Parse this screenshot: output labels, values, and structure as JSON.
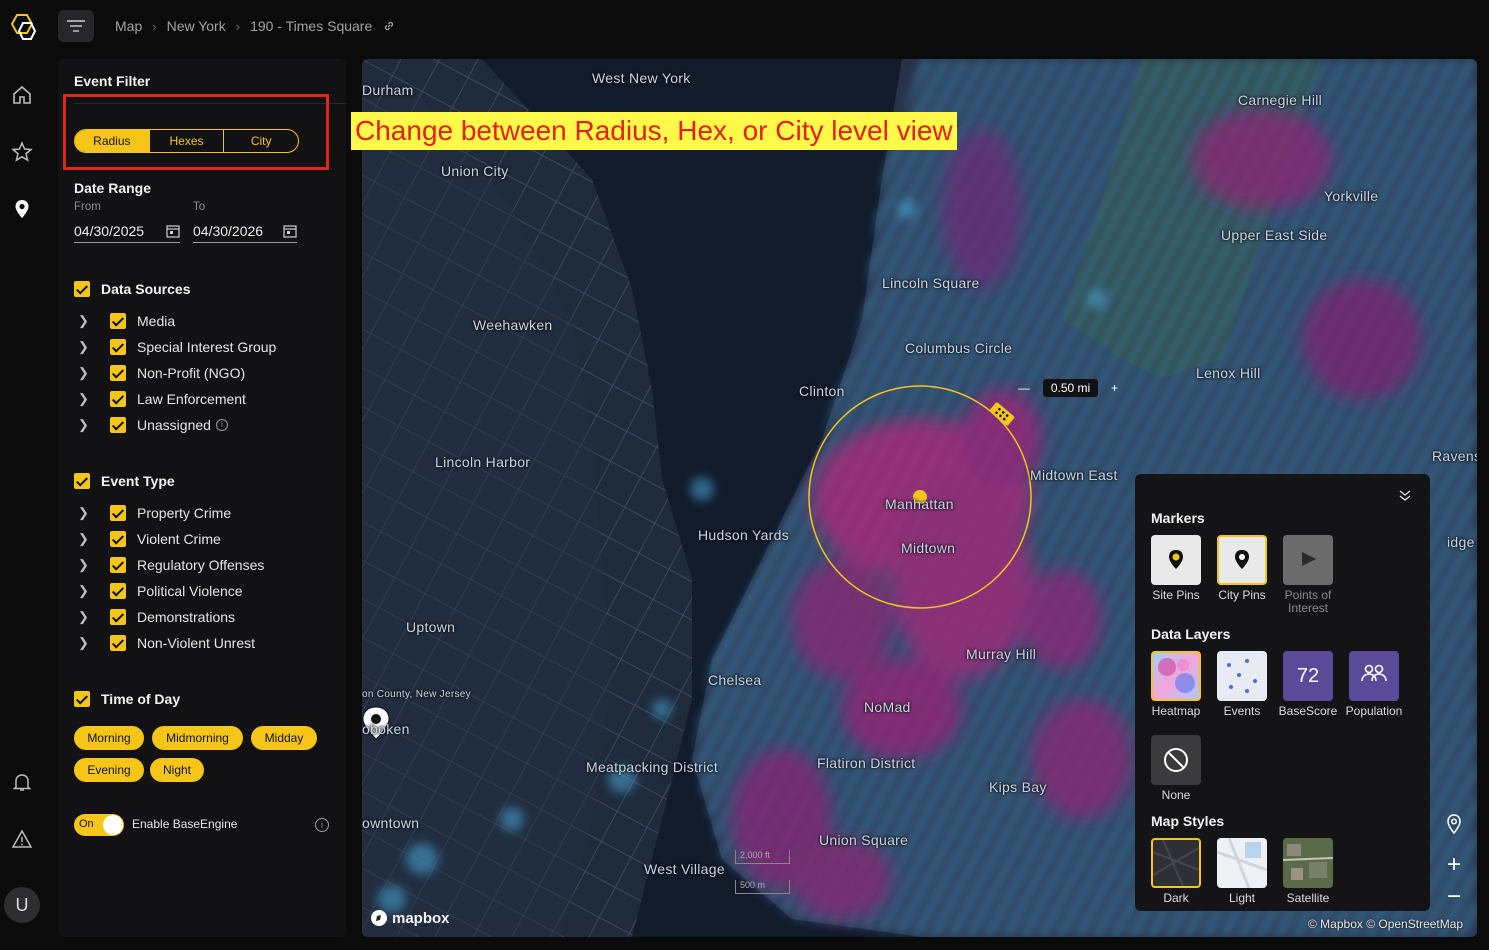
{
  "breadcrumb": {
    "items": [
      "Map",
      "New York",
      "190 - Times Square"
    ]
  },
  "rail": {
    "avatar_initial": "U"
  },
  "filter": {
    "title": "Event Filter",
    "view_modes": [
      "Radius",
      "Hexes",
      "City"
    ],
    "active_view_mode": "Radius",
    "date_range": {
      "label": "Date Range",
      "from_label": "From",
      "from_value": "04/30/2025",
      "to_label": "To",
      "to_value": "04/30/2026"
    },
    "data_sources": {
      "label": "Data Sources",
      "items": [
        "Media",
        "Special Interest Group",
        "Non-Profit (NGO)",
        "Law Enforcement",
        "Unassigned"
      ]
    },
    "event_type": {
      "label": "Event Type",
      "items": [
        "Property Crime",
        "Violent Crime",
        "Regulatory Offenses",
        "Political Violence",
        "Demonstrations",
        "Non-Violent Unrest"
      ]
    },
    "time_of_day": {
      "label": "Time of Day",
      "chips": [
        "Morning",
        "Midmorning",
        "Midday",
        "Evening",
        "Night"
      ]
    },
    "base_engine": {
      "toggle_text": "On",
      "label": "Enable BaseEngine",
      "enabled": true
    }
  },
  "annotation": {
    "callout": "Change between Radius, Hex, or City level view"
  },
  "map": {
    "radius_value": "0.50 mi",
    "labels": {
      "west_new_york": "West New York",
      "durham": "Durham",
      "union_city": "Union City",
      "weehawken": "Weehawken",
      "lincoln_harbor": "Lincoln Harbor",
      "uptown": "Uptown",
      "hudson_county": "on County, New Jersey",
      "oboken": "oboken",
      "owntown": "owntown",
      "carnegie_hill": "Carnegie Hill",
      "yorkville": "Yorkville",
      "upper_east_side": "Upper East Side",
      "lincoln_square": "Lincoln Square",
      "columbus_circle": "Columbus Circle",
      "clinton": "Clinton",
      "lenox_hill": "Lenox Hill",
      "midtown_east": "Midtown East",
      "manhattan": "Manhattan",
      "midtown": "Midtown",
      "hudson_yards": "Hudson Yards",
      "murray_hill": "Murray Hill",
      "chelsea": "Chelsea",
      "nomad": "NoMad",
      "meatpacking": "Meatpacking District",
      "flatiron": "Flatiron District",
      "kips_bay": "Kips Bay",
      "union_square": "Union Square",
      "west_village": "West Village",
      "ravens": "Ravens",
      "idge": "idge"
    },
    "scale_ft": "2,000 ft",
    "scale_m": "500 m",
    "mapbox": "mapbox",
    "attribution": "© Mapbox © OpenStreetMap"
  },
  "layers": {
    "markers": {
      "label": "Markers",
      "items": [
        "Site Pins",
        "City Pins",
        "Points of Interest"
      ],
      "selected": "City Pins"
    },
    "data_layers": {
      "label": "Data Layers",
      "items": [
        "Heatmap",
        "Events",
        "BaseScore",
        "Population",
        "None"
      ],
      "selected": "Heatmap",
      "basescore_value": "72"
    },
    "map_styles": {
      "label": "Map Styles",
      "items": [
        "Dark",
        "Light",
        "Satellite"
      ],
      "selected": "Dark"
    }
  },
  "colors": {
    "accent": "#f5c518",
    "callout_red": "#e3211b",
    "callout_bg": "#fff94a"
  }
}
